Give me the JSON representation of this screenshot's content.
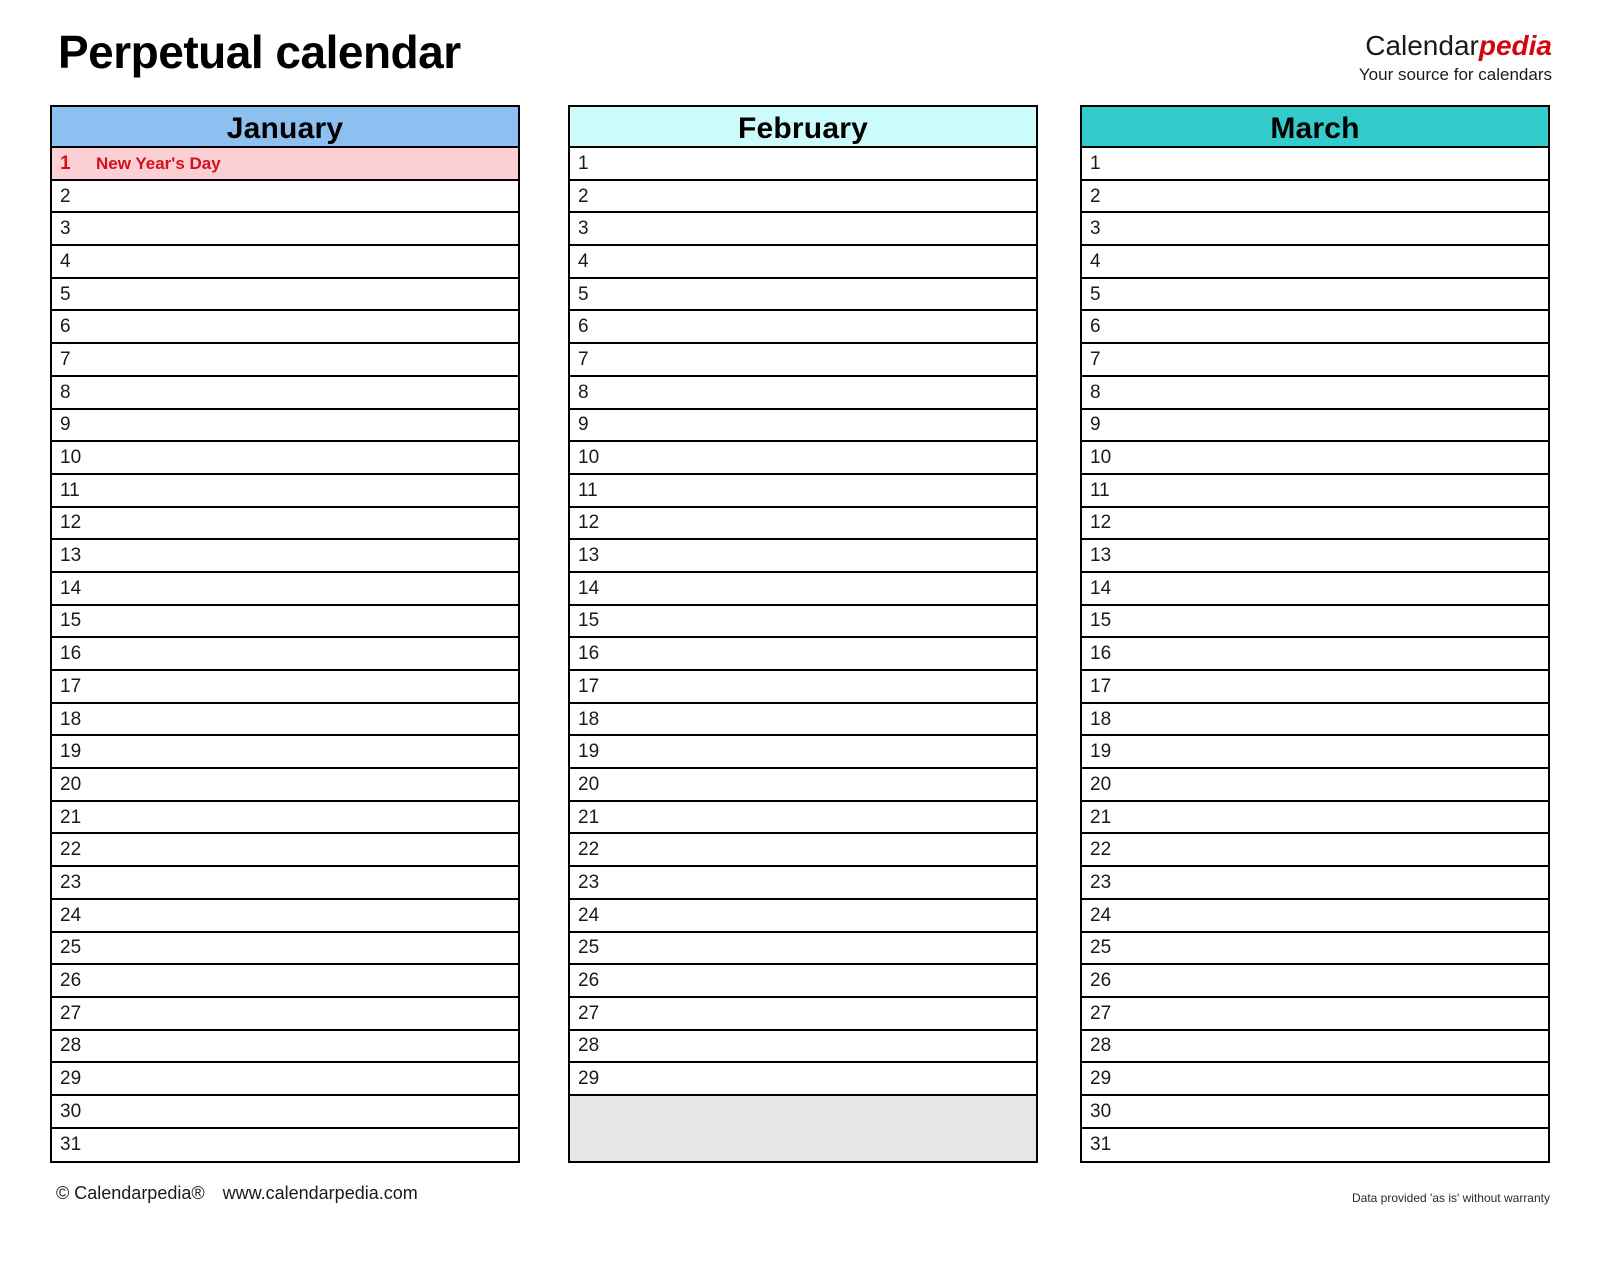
{
  "header": {
    "title": "Perpetual calendar",
    "brand_part1": "Calendar",
    "brand_part2": "pedia",
    "brand_tagline": "Your source for calendars"
  },
  "colors": {
    "january_header": "#8cc0f0",
    "february_header": "#ccfbfb",
    "march_header": "#33cccc",
    "holiday_background": "#fbcfd3",
    "holiday_text": "#d1121c",
    "filler_background": "#e6e6e6",
    "brand_red": "#d3050f",
    "border": "#000000"
  },
  "months": [
    {
      "name": "January",
      "header_color": "#8cc0f0",
      "days": [
        {
          "num": "1",
          "label": "New Year's Day",
          "holiday": true
        },
        {
          "num": "2",
          "label": ""
        },
        {
          "num": "3",
          "label": ""
        },
        {
          "num": "4",
          "label": ""
        },
        {
          "num": "5",
          "label": ""
        },
        {
          "num": "6",
          "label": ""
        },
        {
          "num": "7",
          "label": ""
        },
        {
          "num": "8",
          "label": ""
        },
        {
          "num": "9",
          "label": ""
        },
        {
          "num": "10",
          "label": ""
        },
        {
          "num": "11",
          "label": ""
        },
        {
          "num": "12",
          "label": ""
        },
        {
          "num": "13",
          "label": ""
        },
        {
          "num": "14",
          "label": ""
        },
        {
          "num": "15",
          "label": ""
        },
        {
          "num": "16",
          "label": ""
        },
        {
          "num": "17",
          "label": ""
        },
        {
          "num": "18",
          "label": ""
        },
        {
          "num": "19",
          "label": ""
        },
        {
          "num": "20",
          "label": ""
        },
        {
          "num": "21",
          "label": ""
        },
        {
          "num": "22",
          "label": ""
        },
        {
          "num": "23",
          "label": ""
        },
        {
          "num": "24",
          "label": ""
        },
        {
          "num": "25",
          "label": ""
        },
        {
          "num": "26",
          "label": ""
        },
        {
          "num": "27",
          "label": ""
        },
        {
          "num": "28",
          "label": ""
        },
        {
          "num": "29",
          "label": ""
        },
        {
          "num": "30",
          "label": ""
        },
        {
          "num": "31",
          "label": ""
        }
      ],
      "filler_rows": 0
    },
    {
      "name": "February",
      "header_color": "#ccfbfb",
      "days": [
        {
          "num": "1",
          "label": ""
        },
        {
          "num": "2",
          "label": ""
        },
        {
          "num": "3",
          "label": ""
        },
        {
          "num": "4",
          "label": ""
        },
        {
          "num": "5",
          "label": ""
        },
        {
          "num": "6",
          "label": ""
        },
        {
          "num": "7",
          "label": ""
        },
        {
          "num": "8",
          "label": ""
        },
        {
          "num": "9",
          "label": ""
        },
        {
          "num": "10",
          "label": ""
        },
        {
          "num": "11",
          "label": ""
        },
        {
          "num": "12",
          "label": ""
        },
        {
          "num": "13",
          "label": ""
        },
        {
          "num": "14",
          "label": ""
        },
        {
          "num": "15",
          "label": ""
        },
        {
          "num": "16",
          "label": ""
        },
        {
          "num": "17",
          "label": ""
        },
        {
          "num": "18",
          "label": ""
        },
        {
          "num": "19",
          "label": ""
        },
        {
          "num": "20",
          "label": ""
        },
        {
          "num": "21",
          "label": ""
        },
        {
          "num": "22",
          "label": ""
        },
        {
          "num": "23",
          "label": ""
        },
        {
          "num": "24",
          "label": ""
        },
        {
          "num": "25",
          "label": ""
        },
        {
          "num": "26",
          "label": ""
        },
        {
          "num": "27",
          "label": ""
        },
        {
          "num": "28",
          "label": ""
        },
        {
          "num": "29",
          "label": ""
        }
      ],
      "filler_rows": 2
    },
    {
      "name": "March",
      "header_color": "#33cccc",
      "days": [
        {
          "num": "1",
          "label": ""
        },
        {
          "num": "2",
          "label": ""
        },
        {
          "num": "3",
          "label": ""
        },
        {
          "num": "4",
          "label": ""
        },
        {
          "num": "5",
          "label": ""
        },
        {
          "num": "6",
          "label": ""
        },
        {
          "num": "7",
          "label": ""
        },
        {
          "num": "8",
          "label": ""
        },
        {
          "num": "9",
          "label": ""
        },
        {
          "num": "10",
          "label": ""
        },
        {
          "num": "11",
          "label": ""
        },
        {
          "num": "12",
          "label": ""
        },
        {
          "num": "13",
          "label": ""
        },
        {
          "num": "14",
          "label": ""
        },
        {
          "num": "15",
          "label": ""
        },
        {
          "num": "16",
          "label": ""
        },
        {
          "num": "17",
          "label": ""
        },
        {
          "num": "18",
          "label": ""
        },
        {
          "num": "19",
          "label": ""
        },
        {
          "num": "20",
          "label": ""
        },
        {
          "num": "21",
          "label": ""
        },
        {
          "num": "22",
          "label": ""
        },
        {
          "num": "23",
          "label": ""
        },
        {
          "num": "24",
          "label": ""
        },
        {
          "num": "25",
          "label": ""
        },
        {
          "num": "26",
          "label": ""
        },
        {
          "num": "27",
          "label": ""
        },
        {
          "num": "28",
          "label": ""
        },
        {
          "num": "29",
          "label": ""
        },
        {
          "num": "30",
          "label": ""
        },
        {
          "num": "31",
          "label": ""
        }
      ],
      "filler_rows": 0
    }
  ],
  "footer": {
    "copyright": "© Calendarpedia®",
    "website": "www.calendarpedia.com",
    "disclaimer": "Data provided 'as is' without warranty"
  }
}
